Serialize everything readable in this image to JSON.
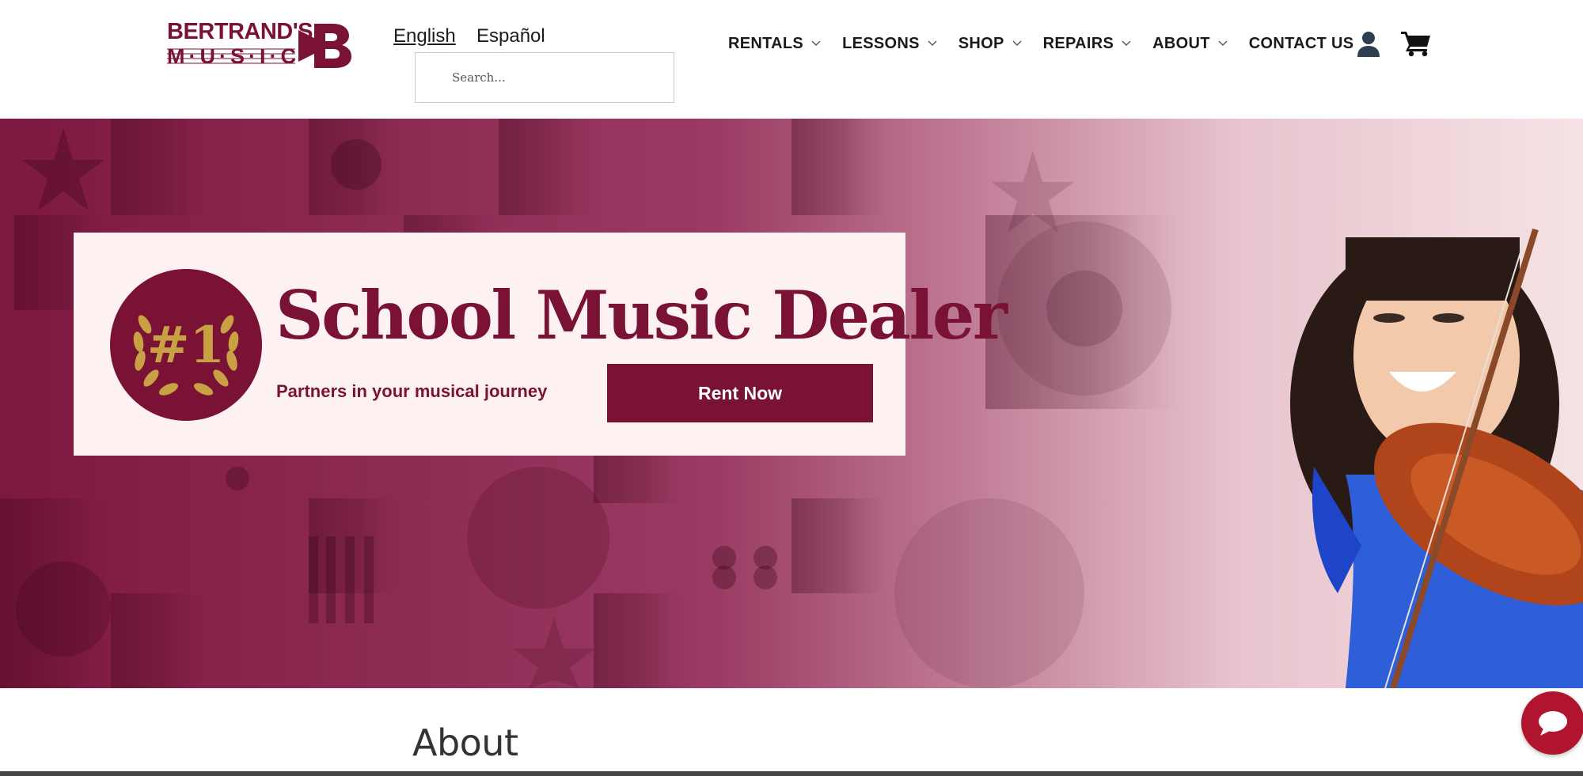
{
  "brand": {
    "logo_line1": "BERTRAND'S",
    "logo_line2": "M·U·S·I·C",
    "logo_mark_letter": "B",
    "color_primary": "#7a1235",
    "color_gold": "#c9a043"
  },
  "language": {
    "english": "English",
    "spanish": "Español",
    "selected": "English"
  },
  "search": {
    "placeholder": "Search...",
    "value": ""
  },
  "nav": {
    "items": [
      {
        "label": "RENTALS",
        "has_dropdown": true
      },
      {
        "label": "LESSONS",
        "has_dropdown": true
      },
      {
        "label": "SHOP",
        "has_dropdown": true
      },
      {
        "label": "REPAIRS",
        "has_dropdown": true
      },
      {
        "label": "ABOUT",
        "has_dropdown": true
      },
      {
        "label": "CONTACT US",
        "has_dropdown": false
      }
    ],
    "icons": [
      "user-icon",
      "cart-icon"
    ]
  },
  "hero": {
    "badge_text": "#1",
    "title": "School Music Dealer",
    "subtitle": "Partners in your musical journey",
    "cta_label": "Rent Now"
  },
  "section": {
    "heading": "About"
  },
  "chat": {
    "icon": "chat-bubble-icon",
    "color": "#b0142e"
  }
}
